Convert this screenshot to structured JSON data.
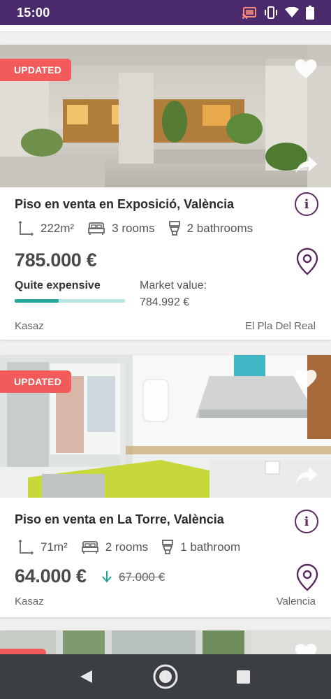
{
  "status_bar": {
    "time": "15:00",
    "icons": [
      "cast-icon",
      "vibrate-icon",
      "wifi-icon",
      "battery-icon"
    ]
  },
  "listings": [
    {
      "badge": "UPDATED",
      "title": "Piso en venta en Exposició, València",
      "area": "222m²",
      "rooms": "3 rooms",
      "bathrooms": "2 bathrooms",
      "price": "785.000 €",
      "price_quality": "Quite expensive",
      "price_quality_level": 0.4,
      "market_value_label": "Market value:",
      "market_value": "784.992 €",
      "source": "Kasaz",
      "location": "El Pla Del Real"
    },
    {
      "badge": "UPDATED",
      "title": "Piso en venta en La Torre, València",
      "area": "71m²",
      "rooms": "2 rooms",
      "bathrooms": "1 bathroom",
      "price": "64.000 €",
      "previous_price": "67.000 €",
      "source": "Kasaz",
      "location": "Valencia"
    }
  ],
  "colors": {
    "status_bar": "#4a2a6b",
    "badge": "#f35a5a",
    "accent_purple": "#5b2a5f",
    "quality_fill": "#20a99a",
    "quality_track": "#b8e6e2",
    "price_drop": "#20a99a",
    "nav_bar": "#3b3f43"
  },
  "nav_bar": {
    "buttons": [
      "back-icon",
      "home-icon",
      "recents-icon"
    ]
  }
}
